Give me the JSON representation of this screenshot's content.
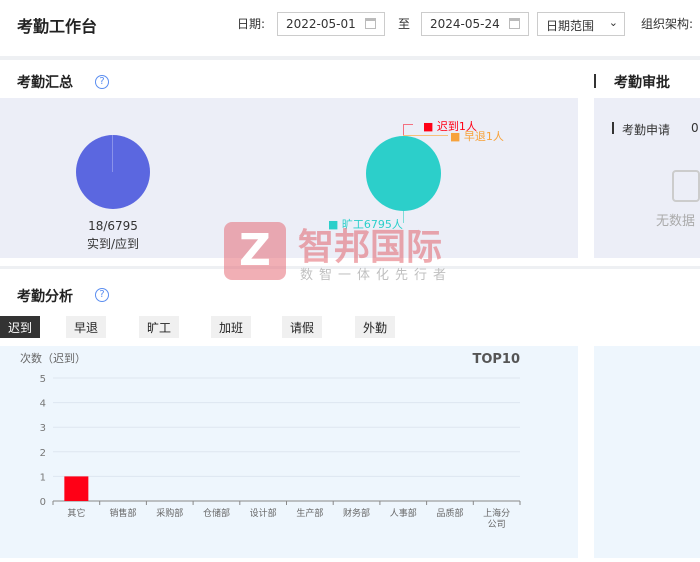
{
  "header": {
    "title": "考勤工作台",
    "date_label": "日期:",
    "start_date": "2022-05-01",
    "to_label": "至",
    "end_date": "2024-05-24",
    "range_select": "日期范围",
    "org_label": "组织架构:"
  },
  "summary": {
    "title": "考勤汇总",
    "pie1": {
      "ratio": "18/6795",
      "caption": "实到/应到",
      "color": "#5b67e0"
    },
    "pie2": {
      "color": "#2ccfca",
      "labels": [
        {
          "text": "迟到1人",
          "color": "#ff0016"
        },
        {
          "text": "早退1人",
          "color": "#f7a23b"
        },
        {
          "text": "旷工6795人",
          "color": "#2ccfca"
        }
      ]
    }
  },
  "approval": {
    "title": "考勤审批",
    "item_label": "考勤申请",
    "item_value": "0",
    "empty_text": "无数据"
  },
  "analysis": {
    "title": "考勤分析",
    "tabs": [
      "迟到",
      "早退",
      "旷工",
      "加班",
      "请假",
      "外勤"
    ],
    "active_tab": "迟到"
  },
  "watermark": {
    "name": "智邦国际",
    "slogan": "数智一体化先行者"
  },
  "chart_data": {
    "type": "bar",
    "ylabel": "次数（迟到）",
    "title": "TOP10",
    "ylim": [
      0,
      5
    ],
    "yticks": [
      0,
      1,
      2,
      3,
      4,
      5
    ],
    "categories": [
      "其它",
      "销售部",
      "采购部",
      "仓储部",
      "设计部",
      "生产部",
      "财务部",
      "人事部",
      "品质部",
      "上海分公司"
    ],
    "values": [
      1,
      0,
      0,
      0,
      0,
      0,
      0,
      0,
      0,
      0
    ],
    "bar_color": "#ff0016",
    "grid": true
  }
}
